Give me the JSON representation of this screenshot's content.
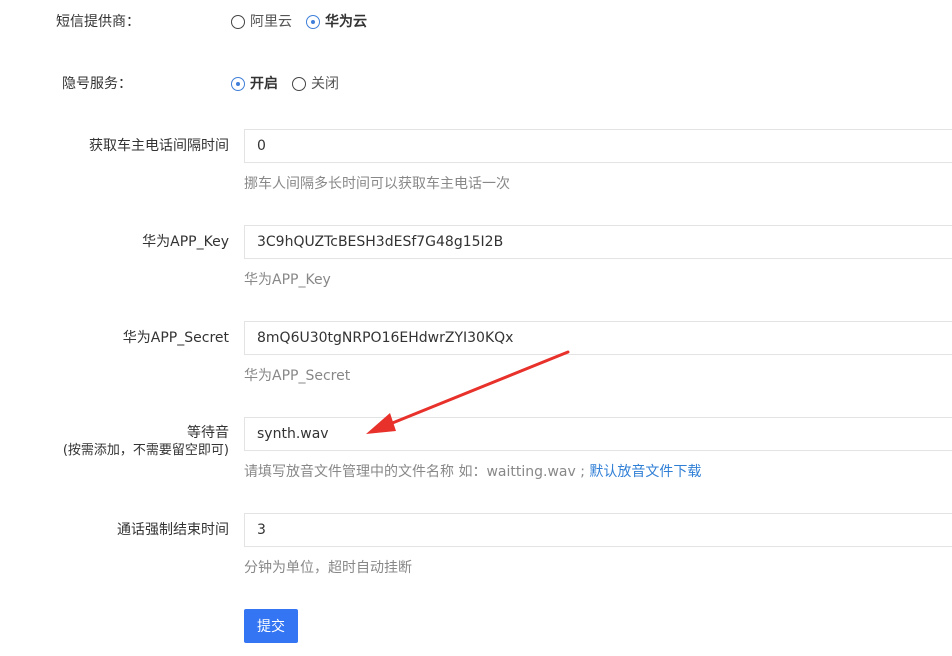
{
  "form": {
    "sms_provider": {
      "label": "短信提供商：",
      "options": [
        {
          "label": "阿里云",
          "checked": false
        },
        {
          "label": "华为云",
          "checked": true
        }
      ]
    },
    "privacy_number": {
      "label": "隐号服务：",
      "options": [
        {
          "label": "开启",
          "checked": true
        },
        {
          "label": "关闭",
          "checked": false
        }
      ]
    },
    "phone_interval": {
      "label": "获取车主电话间隔时间",
      "value": "0",
      "help": "挪车人间隔多长时间可以获取车主电话一次"
    },
    "app_key": {
      "label": "华为APP_Key",
      "value": "3C9hQUZTcBESH3dESf7G48g15I2B",
      "help": "华为APP_Key"
    },
    "app_secret": {
      "label": "华为APP_Secret",
      "value": "8mQ6U30tgNRPO16EHdwrZYI30KQx",
      "help": "华为APP_Secret"
    },
    "waiting_tone": {
      "label": "等待音",
      "sublabel": "(按需添加，不需要留空即可)",
      "value": "synth.wav",
      "help": "请填写放音文件管理中的文件名称 如：waitting.wav ;",
      "link": "默认放音文件下载"
    },
    "call_timeout": {
      "label": "通话强制结束时间",
      "value": "3",
      "help": "分钟为单位，超时自动挂断"
    },
    "submit_label": "提交"
  },
  "colors": {
    "accent": "#3375f2",
    "link": "#2f7fd6",
    "radio_checked": "#3f7fd9",
    "arrow": "#e8312a"
  }
}
